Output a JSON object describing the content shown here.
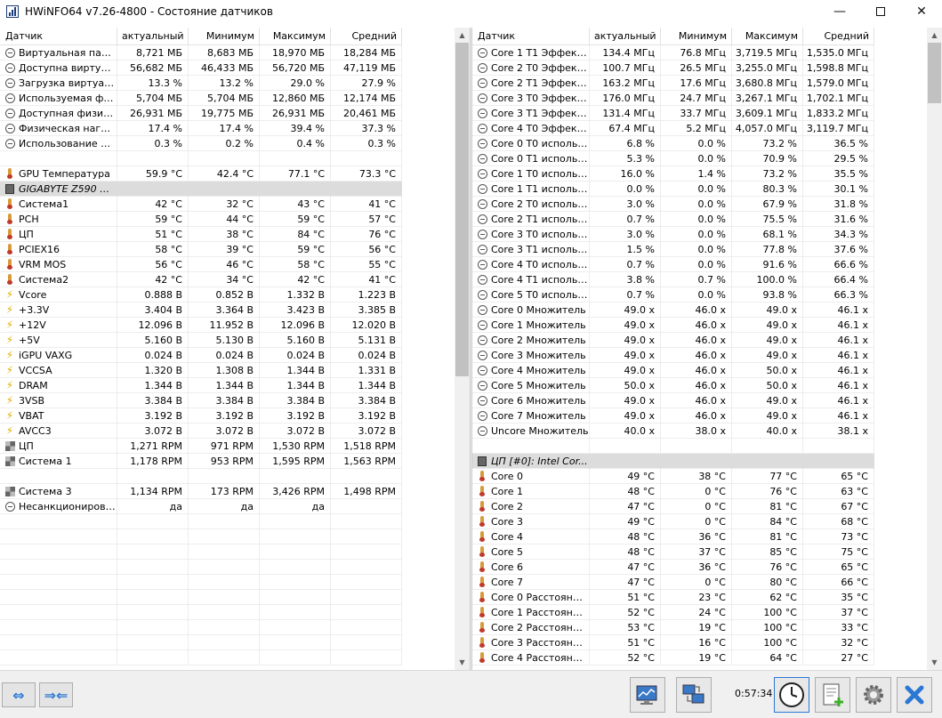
{
  "window": {
    "title": "HWiNFO64 v7.26-4800 - Состояние датчиков",
    "min_glyph": "—",
    "close_glyph": "✕"
  },
  "columns": [
    "Датчик",
    "актуальный",
    "Минимум",
    "Максимум",
    "Средний"
  ],
  "left_rows": [
    {
      "icon": "clock",
      "name": "Виртуальная памя...",
      "cur": "8,721 МБ",
      "min": "8,683 МБ",
      "max": "18,970 МБ",
      "avg": "18,284 МБ"
    },
    {
      "icon": "clock",
      "name": "Доступна виртуал...",
      "cur": "56,682 МБ",
      "min": "46,433 МБ",
      "max": "56,720 МБ",
      "avg": "47,119 МБ"
    },
    {
      "icon": "clock",
      "name": "Загрузка виртуал...",
      "cur": "13.3 %",
      "min": "13.2 %",
      "max": "29.0 %",
      "avg": "27.9 %"
    },
    {
      "icon": "clock",
      "name": "Используемая физ...",
      "cur": "5,704 МБ",
      "min": "5,704 МБ",
      "max": "12,860 МБ",
      "avg": "12,174 МБ"
    },
    {
      "icon": "clock",
      "name": "Доступная физиче...",
      "cur": "26,931 МБ",
      "min": "19,775 МБ",
      "max": "26,931 МБ",
      "avg": "20,461 МБ"
    },
    {
      "icon": "clock",
      "name": "Физическая нагру...",
      "cur": "17.4 %",
      "min": "17.4 %",
      "max": "39.4 %",
      "avg": "37.3 %"
    },
    {
      "icon": "clock",
      "name": "Использование фа...",
      "cur": "0.3 %",
      "min": "0.2 %",
      "max": "0.4 %",
      "avg": "0.3 %"
    },
    {
      "type": "blank"
    },
    {
      "icon": "therm",
      "name": "GPU Температура",
      "cur": "59.9 °C",
      "min": "42.4 °C",
      "max": "77.1 °C",
      "avg": "73.3 °C"
    },
    {
      "type": "group",
      "icon": "chip",
      "name": "GIGABYTE Z590 UD..."
    },
    {
      "icon": "therm",
      "name": "Система1",
      "cur": "42 °C",
      "min": "32 °C",
      "max": "43 °C",
      "avg": "41 °C"
    },
    {
      "icon": "therm",
      "name": "PCH",
      "cur": "59 °C",
      "min": "44 °C",
      "max": "59 °C",
      "avg": "57 °C"
    },
    {
      "icon": "therm",
      "name": "ЦП",
      "cur": "51 °C",
      "min": "38 °C",
      "max": "84 °C",
      "avg": "76 °C"
    },
    {
      "icon": "therm",
      "name": "PCIEX16",
      "cur": "58 °C",
      "min": "39 °C",
      "max": "59 °C",
      "avg": "56 °C"
    },
    {
      "icon": "therm",
      "name": "VRM MOS",
      "cur": "56 °C",
      "min": "46 °C",
      "max": "58 °C",
      "avg": "55 °C"
    },
    {
      "icon": "therm",
      "name": "Система2",
      "cur": "42 °C",
      "min": "34 °C",
      "max": "42 °C",
      "avg": "41 °C"
    },
    {
      "icon": "bolt",
      "name": "Vcore",
      "cur": "0.888 В",
      "min": "0.852 В",
      "max": "1.332 В",
      "avg": "1.223 В"
    },
    {
      "icon": "bolt",
      "name": "+3.3V",
      "cur": "3.404 В",
      "min": "3.364 В",
      "max": "3.423 В",
      "avg": "3.385 В"
    },
    {
      "icon": "bolt",
      "name": "+12V",
      "cur": "12.096 В",
      "min": "11.952 В",
      "max": "12.096 В",
      "avg": "12.020 В"
    },
    {
      "icon": "bolt",
      "name": "+5V",
      "cur": "5.160 В",
      "min": "5.130 В",
      "max": "5.160 В",
      "avg": "5.131 В"
    },
    {
      "icon": "bolt",
      "name": "iGPU VAXG",
      "cur": "0.024 В",
      "min": "0.024 В",
      "max": "0.024 В",
      "avg": "0.024 В"
    },
    {
      "icon": "bolt",
      "name": "VCCSA",
      "cur": "1.320 В",
      "min": "1.308 В",
      "max": "1.344 В",
      "avg": "1.331 В"
    },
    {
      "icon": "bolt",
      "name": "DRAM",
      "cur": "1.344 В",
      "min": "1.344 В",
      "max": "1.344 В",
      "avg": "1.344 В"
    },
    {
      "icon": "bolt",
      "name": "3VSB",
      "cur": "3.384 В",
      "min": "3.384 В",
      "max": "3.384 В",
      "avg": "3.384 В"
    },
    {
      "icon": "bolt",
      "name": "VBAT",
      "cur": "3.192 В",
      "min": "3.192 В",
      "max": "3.192 В",
      "avg": "3.192 В"
    },
    {
      "icon": "bolt",
      "name": "AVCC3",
      "cur": "3.072 В",
      "min": "3.072 В",
      "max": "3.072 В",
      "avg": "3.072 В"
    },
    {
      "icon": "fan",
      "name": "ЦП",
      "cur": "1,271 RPM",
      "min": "971 RPM",
      "max": "1,530 RPM",
      "avg": "1,518 RPM"
    },
    {
      "icon": "fan",
      "name": "Система 1",
      "cur": "1,178 RPM",
      "min": "953 RPM",
      "max": "1,595 RPM",
      "avg": "1,563 RPM"
    },
    {
      "type": "blank"
    },
    {
      "icon": "fan",
      "name": "Система 3",
      "cur": "1,134 RPM",
      "min": "173 RPM",
      "max": "3,426 RPM",
      "avg": "1,498 RPM"
    },
    {
      "icon": "clock",
      "name": "Несанкционирова...",
      "cur": "да",
      "min": "да",
      "max": "да",
      "avg": ""
    },
    {
      "type": "blank"
    },
    {
      "type": "blank"
    },
    {
      "type": "blank"
    },
    {
      "type": "blank"
    },
    {
      "type": "blank"
    },
    {
      "type": "blank"
    },
    {
      "type": "blank"
    },
    {
      "type": "blank"
    },
    {
      "type": "blank"
    },
    {
      "type": "blank"
    }
  ],
  "right_rows": [
    {
      "icon": "clock",
      "name": "Core 1 T1 Эффект...",
      "cur": "134.4 МГц",
      "min": "76.8 МГц",
      "max": "3,719.5 МГц",
      "avg": "1,535.0 МГц"
    },
    {
      "icon": "clock",
      "name": "Core 2 T0 Эффект...",
      "cur": "100.7 МГц",
      "min": "26.5 МГц",
      "max": "3,255.0 МГц",
      "avg": "1,598.8 МГц"
    },
    {
      "icon": "clock",
      "name": "Core 2 T1 Эффект...",
      "cur": "163.2 МГц",
      "min": "17.6 МГц",
      "max": "3,680.8 МГц",
      "avg": "1,579.0 МГц"
    },
    {
      "icon": "clock",
      "name": "Core 3 T0 Эффект...",
      "cur": "176.0 МГц",
      "min": "24.7 МГц",
      "max": "3,267.1 МГц",
      "avg": "1,702.1 МГц"
    },
    {
      "icon": "clock",
      "name": "Core 3 T1 Эффект...",
      "cur": "131.4 МГц",
      "min": "33.7 МГц",
      "max": "3,609.1 МГц",
      "avg": "1,833.2 МГц"
    },
    {
      "icon": "clock",
      "name": "Core 4 T0 Эффект...",
      "cur": "67.4 МГц",
      "min": "5.2 МГц",
      "max": "4,057.0 МГц",
      "avg": "3,119.7 МГц"
    },
    {
      "icon": "clock",
      "name": "Core 0 T0 использ...",
      "cur": "6.8 %",
      "min": "0.0 %",
      "max": "73.2 %",
      "avg": "36.5 %"
    },
    {
      "icon": "clock",
      "name": "Core 0 T1 использ...",
      "cur": "5.3 %",
      "min": "0.0 %",
      "max": "70.9 %",
      "avg": "29.5 %"
    },
    {
      "icon": "clock",
      "name": "Core 1 T0 использ...",
      "cur": "16.0 %",
      "min": "1.4 %",
      "max": "73.2 %",
      "avg": "35.5 %"
    },
    {
      "icon": "clock",
      "name": "Core 1 T1 использ...",
      "cur": "0.0 %",
      "min": "0.0 %",
      "max": "80.3 %",
      "avg": "30.1 %"
    },
    {
      "icon": "clock",
      "name": "Core 2 T0 использ...",
      "cur": "3.0 %",
      "min": "0.0 %",
      "max": "67.9 %",
      "avg": "31.8 %"
    },
    {
      "icon": "clock",
      "name": "Core 2 T1 использ...",
      "cur": "0.7 %",
      "min": "0.0 %",
      "max": "75.5 %",
      "avg": "31.6 %"
    },
    {
      "icon": "clock",
      "name": "Core 3 T0 использ...",
      "cur": "3.0 %",
      "min": "0.0 %",
      "max": "68.1 %",
      "avg": "34.3 %"
    },
    {
      "icon": "clock",
      "name": "Core 3 T1 использ...",
      "cur": "1.5 %",
      "min": "0.0 %",
      "max": "77.8 %",
      "avg": "37.6 %"
    },
    {
      "icon": "clock",
      "name": "Core 4 T0 использ...",
      "cur": "0.7 %",
      "min": "0.0 %",
      "max": "91.6 %",
      "avg": "66.6 %"
    },
    {
      "icon": "clock",
      "name": "Core 4 T1 использ...",
      "cur": "3.8 %",
      "min": "0.7 %",
      "max": "100.0 %",
      "avg": "66.4 %"
    },
    {
      "icon": "clock",
      "name": "Core 5 T0 использ...",
      "cur": "0.7 %",
      "min": "0.0 %",
      "max": "93.8 %",
      "avg": "66.3 %"
    },
    {
      "icon": "clock",
      "name": "Core 0 Множитель",
      "cur": "49.0 x",
      "min": "46.0 x",
      "max": "49.0 x",
      "avg": "46.1 x"
    },
    {
      "icon": "clock",
      "name": "Core 1 Множитель",
      "cur": "49.0 x",
      "min": "46.0 x",
      "max": "49.0 x",
      "avg": "46.1 x"
    },
    {
      "icon": "clock",
      "name": "Core 2 Множитель",
      "cur": "49.0 x",
      "min": "46.0 x",
      "max": "49.0 x",
      "avg": "46.1 x"
    },
    {
      "icon": "clock",
      "name": "Core 3 Множитель",
      "cur": "49.0 x",
      "min": "46.0 x",
      "max": "49.0 x",
      "avg": "46.1 x"
    },
    {
      "icon": "clock",
      "name": "Core 4 Множитель",
      "cur": "49.0 x",
      "min": "46.0 x",
      "max": "50.0 x",
      "avg": "46.1 x"
    },
    {
      "icon": "clock",
      "name": "Core 5 Множитель",
      "cur": "50.0 x",
      "min": "46.0 x",
      "max": "50.0 x",
      "avg": "46.1 x"
    },
    {
      "icon": "clock",
      "name": "Core 6 Множитель",
      "cur": "49.0 x",
      "min": "46.0 x",
      "max": "49.0 x",
      "avg": "46.1 x"
    },
    {
      "icon": "clock",
      "name": "Core 7 Множитель",
      "cur": "49.0 x",
      "min": "46.0 x",
      "max": "49.0 x",
      "avg": "46.1 x"
    },
    {
      "icon": "clock",
      "name": "Uncore Множитель",
      "cur": "40.0 x",
      "min": "38.0 x",
      "max": "40.0 x",
      "avg": "38.1 x"
    },
    {
      "type": "blank"
    },
    {
      "type": "group",
      "icon": "chip",
      "name": "ЦП [#0]: Intel Cor..."
    },
    {
      "icon": "therm",
      "name": "Core 0",
      "cur": "49 °C",
      "min": "38 °C",
      "max": "77 °C",
      "avg": "65 °C"
    },
    {
      "icon": "therm",
      "name": "Core 1",
      "cur": "48 °C",
      "min": "0 °C",
      "max": "76 °C",
      "avg": "63 °C"
    },
    {
      "icon": "therm",
      "name": "Core 2",
      "cur": "47 °C",
      "min": "0 °C",
      "max": "81 °C",
      "avg": "67 °C"
    },
    {
      "icon": "therm",
      "name": "Core 3",
      "cur": "49 °C",
      "min": "0 °C",
      "max": "84 °C",
      "avg": "68 °C"
    },
    {
      "icon": "therm",
      "name": "Core 4",
      "cur": "48 °C",
      "min": "36 °C",
      "max": "81 °C",
      "avg": "73 °C"
    },
    {
      "icon": "therm",
      "name": "Core 5",
      "cur": "48 °C",
      "min": "37 °C",
      "max": "85 °C",
      "avg": "75 °C"
    },
    {
      "icon": "therm",
      "name": "Core 6",
      "cur": "47 °C",
      "min": "36 °C",
      "max": "76 °C",
      "avg": "65 °C"
    },
    {
      "icon": "therm",
      "name": "Core 7",
      "cur": "47 °C",
      "min": "0 °C",
      "max": "80 °C",
      "avg": "66 °C"
    },
    {
      "icon": "therm",
      "name": "Core 0 Расстояние...",
      "cur": "51 °C",
      "min": "23 °C",
      "max": "62 °C",
      "avg": "35 °C"
    },
    {
      "icon": "therm",
      "name": "Core 1 Расстояние...",
      "cur": "52 °C",
      "min": "24 °C",
      "max": "100 °C",
      "avg": "37 °C"
    },
    {
      "icon": "therm",
      "name": "Core 2 Расстояние...",
      "cur": "53 °C",
      "min": "19 °C",
      "max": "100 °C",
      "avg": "33 °C"
    },
    {
      "icon": "therm",
      "name": "Core 3 Расстояние...",
      "cur": "51 °C",
      "min": "16 °C",
      "max": "100 °C",
      "avg": "32 °C"
    },
    {
      "icon": "therm",
      "name": "Core 4 Расстояние...",
      "cur": "52 °C",
      "min": "19 °C",
      "max": "64 °C",
      "avg": "27 °C"
    }
  ],
  "toolbar": {
    "timer": "0:57:34",
    "nav_left": "⇔",
    "nav_right": "⇒⇐"
  },
  "colors": {
    "selection_group": "#dcdcdc",
    "accent": "#2b78d4",
    "close_button": "#2b78d4"
  }
}
